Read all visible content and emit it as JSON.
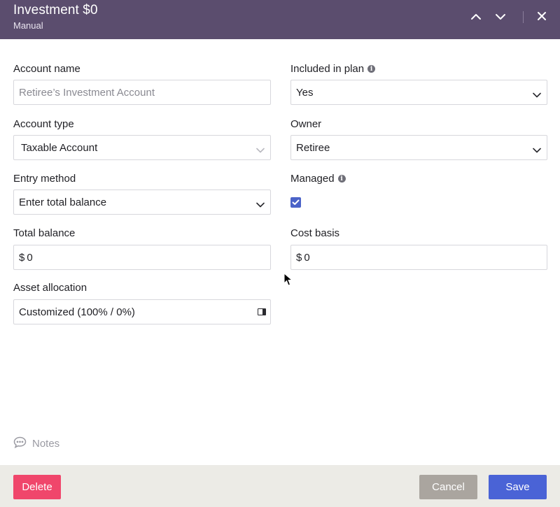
{
  "header": {
    "title": "Investment $0",
    "subtitle": "Manual",
    "icons": {
      "prev": "chevron-up-icon",
      "next": "chevron-down-icon",
      "close": "close-icon"
    }
  },
  "form": {
    "account_name": {
      "label": "Account name",
      "placeholder": "Retiree’s Investment Account"
    },
    "included_in_plan": {
      "label": "Included in plan",
      "value": "Yes"
    },
    "account_type": {
      "label": "Account type",
      "value": "Taxable Account"
    },
    "owner": {
      "label": "Owner",
      "value": "Retiree"
    },
    "entry_method": {
      "label": "Entry method",
      "value": "Enter total balance"
    },
    "managed": {
      "label": "Managed",
      "checked": true
    },
    "total_balance": {
      "label": "Total balance",
      "prefix": "$",
      "value": "0"
    },
    "cost_basis": {
      "label": "Cost basis",
      "prefix": "$",
      "value": "0"
    },
    "asset_allocation": {
      "label": "Asset allocation",
      "value": "Customized (100% / 0%)"
    }
  },
  "notes": {
    "label": "Notes"
  },
  "footer": {
    "delete_label": "Delete",
    "cancel_label": "Cancel",
    "save_label": "Save"
  },
  "colors": {
    "header_bg": "#5b4d6e",
    "delete": "#f0466b",
    "cancel": "#aaa59f",
    "save": "#4a63d6",
    "checkbox": "#4b63c8"
  }
}
